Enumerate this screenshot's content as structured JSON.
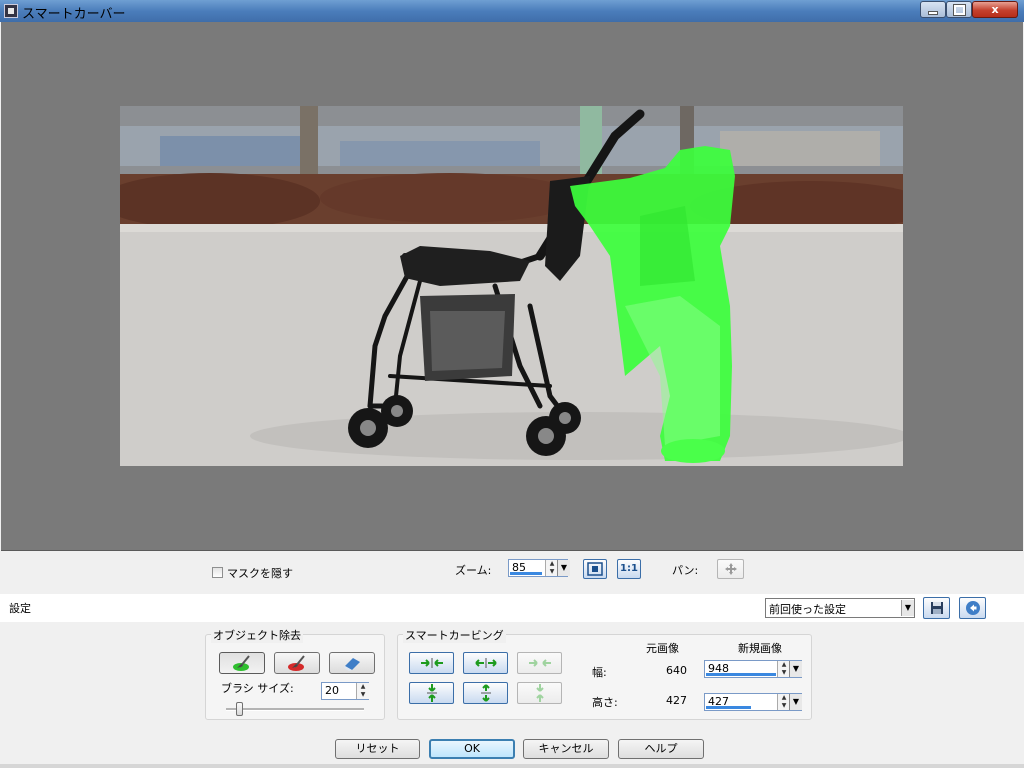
{
  "window": {
    "title": "スマートカーバー",
    "controls": [
      "minimize",
      "maximize",
      "close"
    ],
    "close_glyph": "x"
  },
  "toolbar": {
    "hide_mask_label": "マスクを隠す",
    "hide_mask_checked": false,
    "zoom_label": "ズーム:",
    "zoom_value": "85",
    "fit_icon": "fit-to-window-icon",
    "actual_size_label": "1:1",
    "pan_label": "パン:",
    "pan_icon": "move-icon"
  },
  "settings": {
    "label": "設定",
    "selected": "前回使った設定",
    "save_icon": "floppy-disk-icon",
    "revert_icon": "back-arrow-icon"
  },
  "object_removal": {
    "title": "オブジェクト除去",
    "tools": [
      "keep-brush-icon",
      "remove-brush-icon",
      "eraser-icon"
    ],
    "brush_size_label": "ブラシ サイズ:",
    "brush_size_value": "20",
    "brush_size_slider": 0.1
  },
  "smart_carving": {
    "title": "スマートカービング",
    "buttons": [
      "shrink-horizontal-icon",
      "expand-horizontal-icon",
      "reset-horizontal-icon",
      "shrink-vertical-icon",
      "expand-vertical-icon",
      "reset-vertical-icon"
    ],
    "original_header": "元画像",
    "new_header": "新規画像",
    "width_label": "幅:",
    "height_label": "高さ:",
    "original_width": "640",
    "original_height": "427",
    "new_width": "948",
    "new_height": "427"
  },
  "buttons": {
    "reset": "リセット",
    "ok": "OK",
    "cancel": "キャンセル",
    "help": "ヘルプ"
  },
  "colors": {
    "mask": "#3cff3c",
    "canvas_bg": "#7a7a7a",
    "accent": "#3a88e0"
  }
}
